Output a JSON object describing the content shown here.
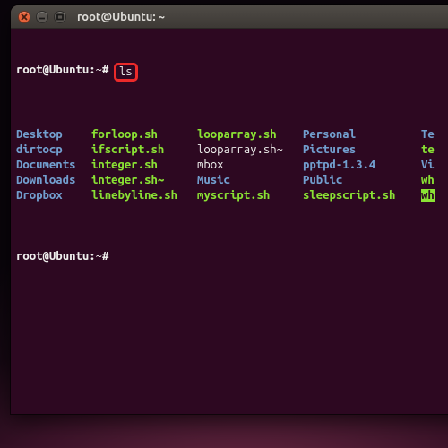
{
  "window": {
    "title": "root@Ubuntu: ~"
  },
  "prompt": {
    "user_host": "root@Ubuntu",
    "path": "~",
    "sep": ":",
    "sigil": "#"
  },
  "command": "ls",
  "listing": {
    "col0": [
      {
        "name": "Desktop",
        "kind": "dir"
      },
      {
        "name": "dirtocp",
        "kind": "dir"
      },
      {
        "name": "Documents",
        "kind": "dir"
      },
      {
        "name": "Downloads",
        "kind": "dir"
      },
      {
        "name": "Dropbox",
        "kind": "dir"
      }
    ],
    "col1": [
      {
        "name": "forloop.sh",
        "kind": "exe"
      },
      {
        "name": "ifscript.sh",
        "kind": "exe"
      },
      {
        "name": "integer.sh",
        "kind": "exe"
      },
      {
        "name": "integer.sh~",
        "kind": "exe"
      },
      {
        "name": "linebyline.sh",
        "kind": "exe"
      }
    ],
    "col2": [
      {
        "name": "looparray.sh",
        "kind": "exe"
      },
      {
        "name": "looparray.sh~",
        "kind": "reg"
      },
      {
        "name": "mbox",
        "kind": "reg"
      },
      {
        "name": "Music",
        "kind": "dir"
      },
      {
        "name": "myscript.sh",
        "kind": "exe"
      }
    ],
    "col3": [
      {
        "name": "Personal",
        "kind": "dir"
      },
      {
        "name": "Pictures",
        "kind": "dir"
      },
      {
        "name": "pptpd-1.3.4",
        "kind": "dir"
      },
      {
        "name": "Public",
        "kind": "dir"
      },
      {
        "name": "sleepscript.sh",
        "kind": "exe"
      }
    ],
    "col4": [
      {
        "name": "Te",
        "kind": "dir"
      },
      {
        "name": "te",
        "kind": "exe"
      },
      {
        "name": "Vi",
        "kind": "dir"
      },
      {
        "name": "wh",
        "kind": "exe"
      },
      {
        "name": "wh",
        "kind": "hl"
      }
    ]
  }
}
